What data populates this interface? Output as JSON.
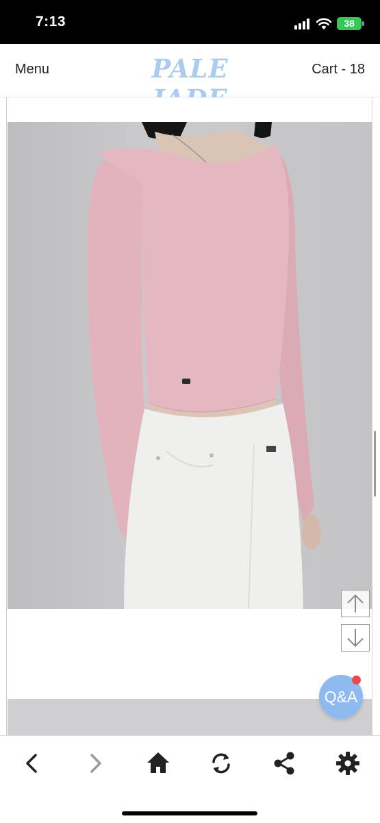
{
  "status_bar": {
    "time": "7:13",
    "battery": "38",
    "battery_color": "#34c759"
  },
  "header": {
    "menu_label": "Menu",
    "brand": "PALE JADE",
    "brand_color": "#a9ccef",
    "cart_label": "Cart - 18"
  },
  "product": {
    "photo_icon": "model-photo",
    "sweater_color": "#e3b5bd",
    "pants_color": "#eeeeec"
  },
  "floating": {
    "qa_label": "Q&A",
    "qa_color": "#8fbaf0",
    "up_icon": "arrow-up-icon",
    "down_icon": "arrow-down-icon"
  },
  "toolbar": {
    "icons": [
      "chevron-left-icon",
      "chevron-right-icon",
      "home-icon",
      "refresh-icon",
      "share-icon",
      "gear-icon"
    ]
  }
}
